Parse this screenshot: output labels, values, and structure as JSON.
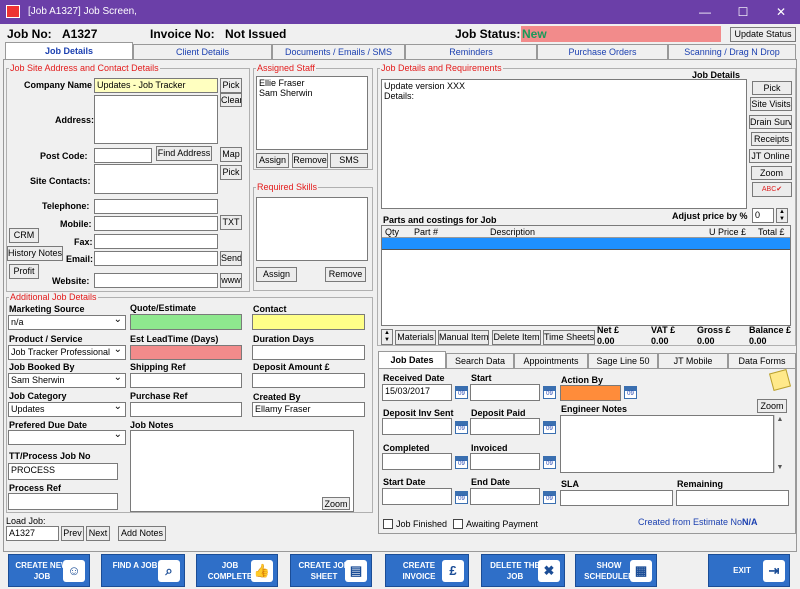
{
  "window": {
    "title": "[Job A1327] Job Screen,",
    "minimize": "—",
    "maximize": "☐",
    "close": "✕"
  },
  "header": {
    "job_no_label": "Job No:",
    "job_no": "A1327",
    "invoice_label": "Invoice No:",
    "invoice_value": "Not Issued",
    "status_label": "Job Status:",
    "status_value": "New",
    "update_status": "Update Status"
  },
  "tabs": [
    "Job Details",
    "Client Details",
    "Documents / Emails / SMS",
    "Reminders",
    "Purchase Orders",
    "Scanning / Drag N Drop"
  ],
  "site": {
    "group_title": "Job Site Address and Contact Details",
    "company_label": "Company Name",
    "company_value": "Updates - Job Tracker",
    "pick": "Pick",
    "clear": "Clear",
    "address_label": "Address:",
    "address_value": "",
    "postcode_label": "Post Code:",
    "find_address": "Find Address",
    "map": "Map",
    "site_contacts_label": "Site Contacts:",
    "pick2": "Pick",
    "telephone_label": "Telephone:",
    "mobile_label": "Mobile:",
    "txt": "TXT",
    "fax_label": "Fax:",
    "email_label": "Email:",
    "send": "Send",
    "website_label": "Website:",
    "www": "www",
    "crm": "CRM",
    "history_notes": "History Notes",
    "profit": "Profit"
  },
  "staff": {
    "group_title": "Assigned Staff",
    "members": [
      "Ellie Fraser",
      "Sam Sherwin"
    ],
    "assign": "Assign",
    "remove": "Remove",
    "sms": "SMS"
  },
  "skills": {
    "group_title": "Required Skills",
    "assign": "Assign",
    "remove": "Remove"
  },
  "details": {
    "group_title": "Job Details and Requirements",
    "heading": "Job Details",
    "text": "Update version XXX\nDetails:",
    "buttons": [
      "Pick",
      "Site Visits",
      "Drain Survey",
      "Receipts",
      "JT Online",
      "Zoom"
    ],
    "spell": "ABC✔"
  },
  "parts": {
    "heading": "Parts and costings for Job",
    "adjust_label": "Adjust price by %",
    "adjust_value": "0",
    "columns": [
      "Qty",
      "Part #",
      "Description",
      "U Price £",
      "Total £"
    ],
    "buttons": [
      "Materials",
      "Manual Item",
      "Delete Item",
      "Time Sheets"
    ],
    "totals": [
      {
        "label": "Net £",
        "value": "0.00"
      },
      {
        "label": "VAT £",
        "value": "0.00"
      },
      {
        "label": "Gross £",
        "value": "0.00"
      },
      {
        "label": "Balance £",
        "value": "0.00"
      }
    ]
  },
  "additional": {
    "group_title": "Additional Job Details",
    "marketing_label": "Marketing Source",
    "marketing_value": "n/a",
    "product_label": "Product / Service",
    "product_value": "Job Tracker Professional",
    "booked_label": "Job Booked By",
    "booked_value": "Sam Sherwin",
    "category_label": "Job Category",
    "category_value": "Updates",
    "due_label": "Prefered Due Date",
    "tt_label": "TT/Process Job No",
    "tt_value": "PROCESS",
    "process_ref_label": "Process Ref",
    "quote_label": "Quote/Estimate",
    "lead_label": "Est LeadTime (Days)",
    "shipping_label": "Shipping Ref",
    "purchase_label": "Purchase Ref",
    "notes_label": "Job Notes",
    "zoom": "Zoom",
    "contact_label": "Contact",
    "duration_label": "Duration Days",
    "deposit_label": "Deposit Amount £",
    "created_label": "Created By",
    "created_value": "Ellamy Fraser"
  },
  "load": {
    "label": "Load Job:",
    "value": "A1327",
    "prev": "Prev",
    "next": "Next",
    "add_notes": "Add Notes"
  },
  "lower_tabs": [
    "Job Dates",
    "Search Data",
    "Appointments",
    "Sage Line 50",
    "JT Mobile",
    "Data Forms"
  ],
  "dates": {
    "received_label": "Received Date",
    "received_value": "15/03/2017",
    "start_label": "Start",
    "action_label": "Action By",
    "deposit_inv_label": "Deposit Inv Sent",
    "deposit_paid_label": "Deposit Paid",
    "engineer_label": "Engineer Notes",
    "zoom": "Zoom",
    "completed_label": "Completed",
    "invoiced_label": "Invoiced",
    "start_date_label": "Start Date",
    "end_date_label": "End Date",
    "sla_label": "SLA",
    "remaining_label": "Remaining",
    "job_finished": "Job Finished",
    "awaiting_payment": "Awaiting Payment",
    "created_from": "Created from Estimate  No:",
    "created_from_value": "N/A",
    "cal": "09"
  },
  "bottom": [
    {
      "label": "CREATE NEW JOB",
      "icon": "new-job-icon",
      "glyph": "☺"
    },
    {
      "label": "FIND A JOB",
      "icon": "magnifier-icon",
      "glyph": "⌕"
    },
    {
      "label": "JOB COMPLETE",
      "icon": "thumbs-up-icon",
      "glyph": "👍"
    },
    {
      "label": "CREATE JOB SHEET",
      "icon": "document-icon",
      "glyph": "▤"
    },
    {
      "label": "CREATE INVOICE",
      "icon": "invoice-icon",
      "glyph": "£"
    },
    {
      "label": "DELETE THE JOB",
      "icon": "delete-icon",
      "glyph": "✖"
    },
    {
      "label": "SHOW SCHEDULER",
      "icon": "scheduler-icon",
      "glyph": "▦"
    },
    {
      "label": "EXIT",
      "icon": "exit-door-icon",
      "glyph": "⇥"
    }
  ],
  "colors": {
    "titlebar": "#6b3fa8",
    "status": "#f28b8b",
    "status_text": "#1a9a5a",
    "quote": "#8ee88e",
    "contact": "#ffff88",
    "lead": "#f28b8b",
    "action": "#ff8c3a",
    "company": "#ffffc0",
    "grid_header": "#1e90ff",
    "button": "#2f6fc8",
    "group_title": "#e31b1b"
  }
}
